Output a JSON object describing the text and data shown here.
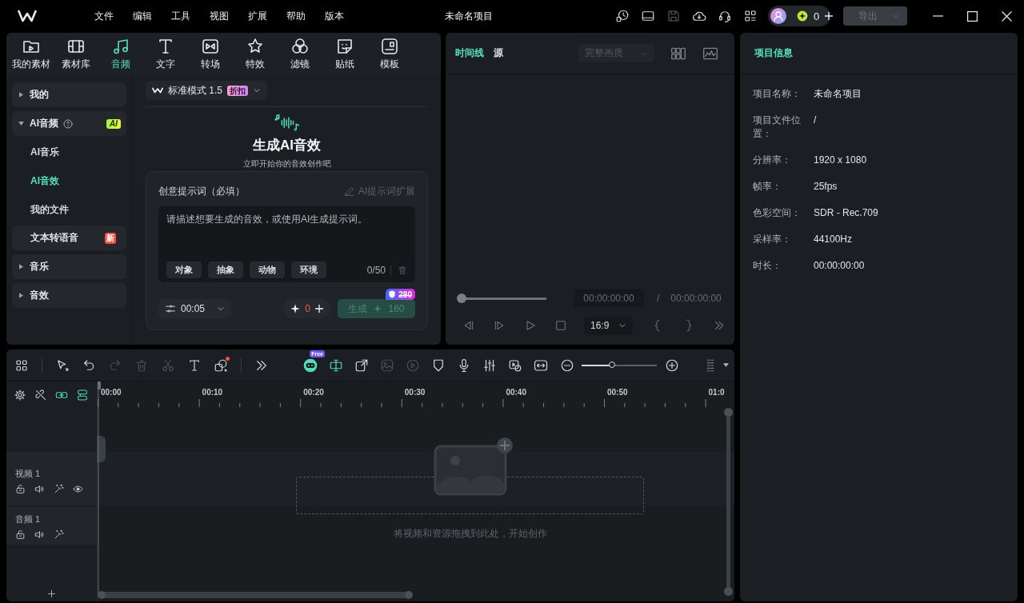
{
  "title_bar": {
    "menu": [
      "文件",
      "编辑",
      "工具",
      "视图",
      "扩展",
      "帮助",
      "版本"
    ],
    "title": "未命名项目",
    "tools": [
      {
        "kind": "history",
        "disabled": false
      },
      {
        "kind": "layout",
        "disabled": false
      },
      {
        "kind": "save",
        "disabled": true
      },
      {
        "kind": "cloud",
        "disabled": false
      },
      {
        "kind": "support",
        "disabled": false
      },
      {
        "kind": "apps",
        "disabled": false
      }
    ],
    "credits": "0",
    "export_button": {
      "label": "导出",
      "disabled": true
    }
  },
  "media_tabs": [
    {
      "label": "我的素材",
      "kind": "my-media",
      "selected": false
    },
    {
      "label": "素材库",
      "kind": "library",
      "selected": false
    },
    {
      "label": "音频",
      "kind": "audio",
      "selected": true
    },
    {
      "label": "文字",
      "kind": "text",
      "selected": false
    },
    {
      "label": "转场",
      "kind": "transition",
      "selected": false
    },
    {
      "label": "特效",
      "kind": "effects",
      "selected": false
    },
    {
      "label": "滤镜",
      "kind": "filters",
      "selected": false
    },
    {
      "label": "贴纸",
      "kind": "stickers",
      "selected": false
    },
    {
      "label": "模板",
      "kind": "templates",
      "selected": false
    }
  ],
  "sidebar": [
    {
      "kind": "group",
      "label": "我的",
      "expanded": false
    },
    {
      "kind": "group",
      "label": "AI音频",
      "expanded": true,
      "help": true,
      "badge": {
        "label": "AI",
        "kind": "ai"
      },
      "children": [
        {
          "label": "AI音乐",
          "selected": false
        },
        {
          "label": "AI音效",
          "selected": true
        },
        {
          "label": "我的文件",
          "selected": false
        }
      ]
    },
    {
      "kind": "item",
      "label": "文本转语音",
      "badge": {
        "label": "新",
        "kind": "new"
      }
    },
    {
      "kind": "group",
      "label": "音乐",
      "expanded": false
    },
    {
      "kind": "group",
      "label": "音效",
      "expanded": false
    }
  ],
  "ai_panel": {
    "mode": {
      "label": "标准模式 1.5",
      "tag": "折扣"
    },
    "title": "生成AI音效",
    "subtitle": "立即开始你的音效创作吧",
    "prompt": {
      "label": "创意提示词（必填）",
      "expand": {
        "label": "AI提示词扩展",
        "disabled": true
      },
      "placeholder": "请描述想要生成的音效，或使用AI生成提示词。",
      "chips": [
        "对象",
        "抽象",
        "动物",
        "环境"
      ],
      "counter": "0/50"
    },
    "duration": "00:05",
    "credits": "0",
    "generate": {
      "label": "生成",
      "cost": "160",
      "original_cost": "280",
      "disabled": true
    }
  },
  "preview": {
    "tabs": [
      {
        "label": "时间线",
        "selected": true
      },
      {
        "label": "源",
        "selected": false
      }
    ],
    "quality": {
      "label": "完整画质",
      "disabled": true
    },
    "scrubber": {
      "level": 0
    },
    "current_time": "00:00:00:00",
    "separator": "/",
    "total_time": "00:00:00:00",
    "aspect": "16:9"
  },
  "project_info": {
    "title": "项目信息",
    "fields": [
      {
        "label": "项目名称：",
        "value": "未命名项目"
      },
      {
        "label": "项目文件位置：",
        "value": "/"
      },
      {
        "label": "分辨率：",
        "value": "1920 x 1080"
      },
      {
        "label": "帧率：",
        "value": "25fps"
      },
      {
        "label": "色彩空间：",
        "value": "SDR - Rec.709"
      },
      {
        "label": "采样率：",
        "value": "44100Hz"
      },
      {
        "label": "时长：",
        "value": "00:00:00:00"
      }
    ]
  },
  "timeline": {
    "tool_groups": [
      {
        "tools": [
          {
            "kind": "grid",
            "disabled": false,
            "active": false,
            "notice": false
          }
        ]
      },
      {
        "tools": [
          {
            "kind": "select",
            "disabled": false,
            "active": false,
            "notice": false
          },
          {
            "kind": "undo",
            "disabled": false,
            "active": false,
            "notice": false
          },
          {
            "kind": "redo",
            "disabled": true,
            "active": false,
            "notice": false
          },
          {
            "kind": "delete",
            "disabled": true,
            "active": false,
            "notice": false
          },
          {
            "kind": "cut",
            "disabled": true,
            "active": false,
            "notice": false
          },
          {
            "kind": "text",
            "disabled": false,
            "active": false,
            "notice": false
          },
          {
            "kind": "shapes",
            "disabled": false,
            "active": false,
            "notice": true
          }
        ]
      },
      {
        "tools": [
          {
            "kind": "more",
            "disabled": false,
            "active": false,
            "notice": false
          }
        ]
      }
    ],
    "ai_tools": [
      {
        "kind": "ai-mate",
        "badge": "Free",
        "disabled": false,
        "active": true
      },
      {
        "kind": "split",
        "disabled": false,
        "active": true
      },
      {
        "kind": "export-clip",
        "disabled": false,
        "active": false
      },
      {
        "kind": "image",
        "disabled": true,
        "active": false
      },
      {
        "kind": "speed",
        "disabled": true,
        "active": false
      },
      {
        "kind": "marker",
        "disabled": false,
        "active": false
      },
      {
        "kind": "mic",
        "disabled": false,
        "active": false
      },
      {
        "kind": "mixer",
        "disabled": false,
        "active": false
      },
      {
        "kind": "replace",
        "disabled": false,
        "active": false
      },
      {
        "kind": "fit",
        "disabled": false,
        "active": false
      }
    ],
    "zoom": {
      "level": 0.4
    },
    "track_tools": [
      {
        "kind": "settings",
        "active": false
      },
      {
        "kind": "unlink",
        "active": false
      },
      {
        "kind": "link",
        "active": true
      },
      {
        "kind": "track-link",
        "active": true
      }
    ],
    "ruler": [
      "00:00",
      "00:10",
      "00:20",
      "00:30",
      "00:40",
      "00:50",
      "01:0"
    ],
    "tracks": [
      {
        "name": "视频 1",
        "kind": "video"
      },
      {
        "name": "音频 1",
        "kind": "audio"
      }
    ],
    "drop_hint": "将视频和资源拖拽到此处，开始创作"
  }
}
